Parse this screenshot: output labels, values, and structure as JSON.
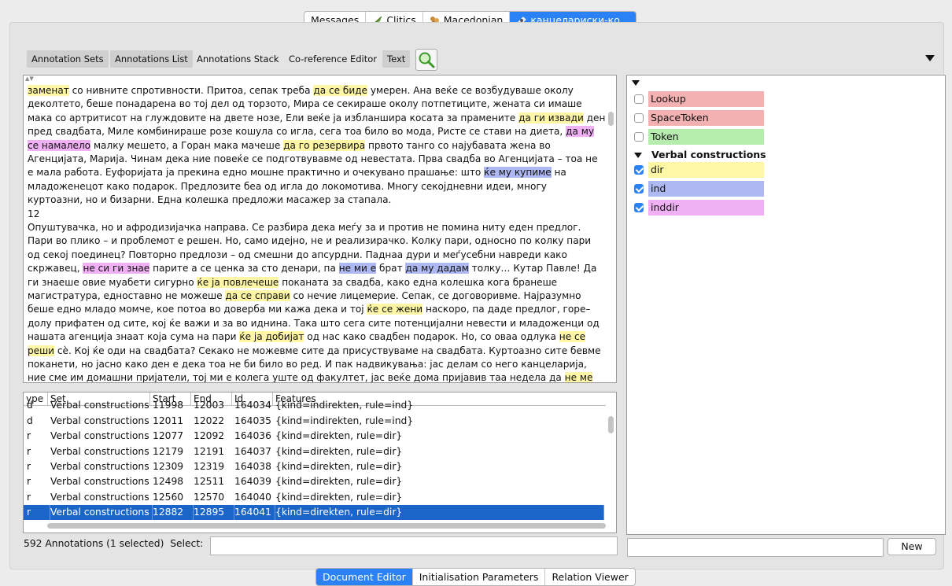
{
  "top_tabs": [
    {
      "label": "Messages",
      "icon": "",
      "selected": false
    },
    {
      "label": "Clitics",
      "icon": "feather-icon",
      "selected": false
    },
    {
      "label": "Macedonian",
      "icon": "corpus-icon",
      "selected": false
    },
    {
      "label": "канцелариски-ко…",
      "icon": "document-icon",
      "selected": true
    }
  ],
  "toolbar": {
    "annotation_sets": "Annotation Sets",
    "annotations_list": "Annotations List",
    "annotations_stack": "Annotations Stack",
    "coreference_editor": "Co-reference Editor",
    "text": "Text"
  },
  "document_lines": [
    [
      [
        "заменат",
        "dir"
      ],
      [
        " со нивните спротивности. Притоа, сепак треба ",
        ""
      ],
      [
        "да се биде",
        "dir"
      ],
      [
        " умерен. Ана веќе се возбудуваше околу",
        ""
      ]
    ],
    [
      [
        "деколтето, беше понадарена во тој дел од торзото, Мира се секираше околу потпетиците, жената си имаше",
        ""
      ]
    ],
    [
      [
        "мака со артритисот на глуждовите на двете нозе, Ели веќе ја избланшира косата за прамените ",
        ""
      ],
      [
        "да ги извади",
        "dir"
      ],
      [
        " ден",
        ""
      ]
    ],
    [
      [
        "пред свадбата, Миле комбинираше розе кошула со игла, сега тоа било во мода, Ристе се стави на диета, ",
        ""
      ],
      [
        "да му",
        "inddir"
      ]
    ],
    [
      [
        "се намалело",
        "inddir"
      ],
      [
        " малку мешето, а Горан мака мачеше ",
        ""
      ],
      [
        "да го резервира",
        "dir"
      ],
      [
        " првото танго со најубавата жена во",
        ""
      ]
    ],
    [
      [
        "Агенцијата, Марија. Чинам дека ние повеќе се подготвувавме од невестата. Прва свадба во Агенцијата – тоа  не",
        ""
      ]
    ],
    [
      [
        "е мала работа. Еуфоријата ја прекина едно мошне практично и очекувано прашање: што ",
        ""
      ],
      [
        "ќе му купиме",
        "ind"
      ],
      [
        " на",
        ""
      ]
    ],
    [
      [
        "младоженецот како подарок. Предлозите беа од игла до локомотива. Многу секојдневни идеи, многу",
        ""
      ]
    ],
    [
      [
        "куртоазни, но и бизарни. Една колешка предложи масажер за стапала.",
        ""
      ]
    ],
    [
      [
        "12",
        ""
      ]
    ],
    [
      [
        "Опуштувачка, но и афродизијачка направа. Се разбира дека меѓу за и против не помина ниту еден предлог.",
        ""
      ]
    ],
    [
      [
        "Пари во плико – и проблемот е решен. Но, само идејно, не и реализирачко. Колку пари, односно по колку пари",
        ""
      ]
    ],
    [
      [
        "од секој поединец? Повторно предлози – од смешни до апсурдни. Паднаа дури и меѓусебни навреди како",
        ""
      ]
    ],
    [
      [
        "скржавец, ",
        ""
      ],
      [
        "не си ги знае",
        "inddir"
      ],
      [
        " парите а се ценка за сто денари, па ",
        ""
      ],
      [
        "не ми е",
        "ind"
      ],
      [
        " брат ",
        ""
      ],
      [
        "да му дадам",
        "ind"
      ],
      [
        " толку… Кутар Павле! Да",
        ""
      ]
    ],
    [
      [
        "ги знаеше овие муабети сигурно ",
        ""
      ],
      [
        "ќе ја повлечеше",
        "dir"
      ],
      [
        " поканата за свадба, како една колешка кога бранеше",
        ""
      ]
    ],
    [
      [
        "магистратура, едноставно не можеше ",
        ""
      ],
      [
        "да се справи",
        "dir"
      ],
      [
        " со нечие лицемерие. Сепак, се договоривме. Најразумно",
        ""
      ]
    ],
    [
      [
        "беше едно младо момче, кое потоа во доверба ми кажа дека и тој ",
        ""
      ],
      [
        "ќе се жени",
        "dir"
      ],
      [
        " наскоро, па даде предлог, горе–",
        ""
      ]
    ],
    [
      [
        "долу прифатен од сите, кој ќе важи и за во иднина. Така што сега сите потенцијални невести и младоженци од",
        ""
      ]
    ],
    [
      [
        "нашата агенција знаат која сума на пари ",
        ""
      ],
      [
        "ќе ја добијат",
        "dir"
      ],
      [
        " од нас како свадбен подарок. Но, со оваа одлука ",
        ""
      ],
      [
        "не се",
        "dir"
      ]
    ],
    [
      [
        "реши",
        "dir"
      ],
      [
        " сè. Кој ќе оди на свадбата? Секако не можевме сите да присуствуваме на свадбата. Куртоазно сите бевме",
        ""
      ]
    ],
    [
      [
        "поканети, но јасно како ден е дека тоа не би било во ред. И пак надвикувања: јас делам со него канцеларија,",
        ""
      ]
    ],
    [
      [
        "ние сме им домашни пријатели, тој ми е колега уште од факултет, јас веќе дома пријавив таа недела да ",
        ""
      ],
      [
        "не ме",
        "dir"
      ]
    ]
  ],
  "table": {
    "headers": [
      "ype",
      "Set",
      "Start",
      "End",
      "Id",
      "Features"
    ],
    "partial_row": {
      "type": "d",
      "set": "Verbal constructions",
      "start": "11998",
      "end": "12003",
      "id": "164034",
      "features": "{kind=indirekten, rule=ind}"
    },
    "rows": [
      {
        "type": "d",
        "set": "Verbal constructions",
        "start": "12011",
        "end": "12022",
        "id": "164035",
        "features": "{kind=indirekten, rule=ind}",
        "selected": false
      },
      {
        "type": "r",
        "set": "Verbal constructions",
        "start": "12077",
        "end": "12092",
        "id": "164036",
        "features": "{kind=direkten, rule=dir}",
        "selected": false
      },
      {
        "type": "r",
        "set": "Verbal constructions",
        "start": "12179",
        "end": "12191",
        "id": "164037",
        "features": "{kind=direkten, rule=dir}",
        "selected": false
      },
      {
        "type": "r",
        "set": "Verbal constructions",
        "start": "12309",
        "end": "12319",
        "id": "164038",
        "features": "{kind=direkten, rule=dir}",
        "selected": false
      },
      {
        "type": "r",
        "set": "Verbal constructions",
        "start": "12498",
        "end": "12511",
        "id": "164039",
        "features": "{kind=direkten, rule=dir}",
        "selected": false
      },
      {
        "type": "r",
        "set": "Verbal constructions",
        "start": "12560",
        "end": "12570",
        "id": "164040",
        "features": "{kind=direkten, rule=dir}",
        "selected": false
      },
      {
        "type": "r",
        "set": "Verbal constructions",
        "start": "12882",
        "end": "12895",
        "id": "164041",
        "features": "{kind=direkten, rule=dir}",
        "selected": true
      }
    ]
  },
  "status": {
    "text": "592 Annotations (1 selected)",
    "select_label": "Select:",
    "select_value": ""
  },
  "annotation_sets": {
    "default_items": [
      {
        "label": "Lookup",
        "checked": false,
        "color": "#f3b1b1"
      },
      {
        "label": "SpaceToken",
        "checked": false,
        "color": "#f3b1b1"
      },
      {
        "label": "Token",
        "checked": false,
        "color": "#b6ecae"
      }
    ],
    "group_label": "Verbal constructions",
    "group_items": [
      {
        "label": "dir",
        "checked": true,
        "color": "#fff7a6"
      },
      {
        "label": "ind",
        "checked": true,
        "color": "#aeb8f2"
      },
      {
        "label": "inddir",
        "checked": true,
        "color": "#f0b0f4"
      }
    ],
    "new_input": "",
    "new_button": "New"
  },
  "bottom_tabs": [
    {
      "label": "Document Editor",
      "selected": true
    },
    {
      "label": "Initialisation Parameters",
      "selected": false
    },
    {
      "label": "Relation Viewer",
      "selected": false
    }
  ],
  "colors": {
    "accent": "#2b82f6",
    "selection": "#1b64c8",
    "dir": "#fff7a6",
    "ind": "#aeb8f2",
    "inddir": "#f0b0f4"
  }
}
